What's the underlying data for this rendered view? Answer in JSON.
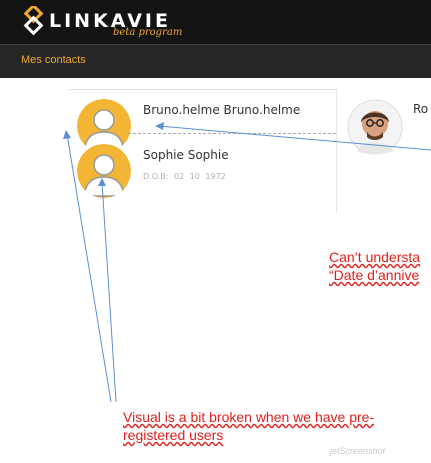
{
  "app": {
    "logo_text": "LINKAVIE",
    "logo_subtitle": "beta program"
  },
  "nav": {
    "items": [
      {
        "label": "Mes contacts"
      }
    ]
  },
  "contacts": [
    {
      "name": "Bruno.helme Bruno.helme",
      "dob": ""
    },
    {
      "name": "Sophie Sophie",
      "dob": "D.O.B: 02 10 1972"
    }
  ],
  "right_contact": {
    "name_partial": "Ro"
  },
  "annotations": {
    "note1": [
      "Can’t understa",
      "“Date d’annive"
    ],
    "note2": [
      "Visual is a bit broken when we have pre-",
      "registered users"
    ]
  },
  "watermark": "jetScreenshot",
  "colors": {
    "accent": "#f0a830",
    "annotation_text": "#e0201e",
    "arrow": "#5b8fd0",
    "header_bg": "#141414"
  },
  "icons": [
    "linkavie-logo-icon",
    "default-avatar-icon"
  ]
}
